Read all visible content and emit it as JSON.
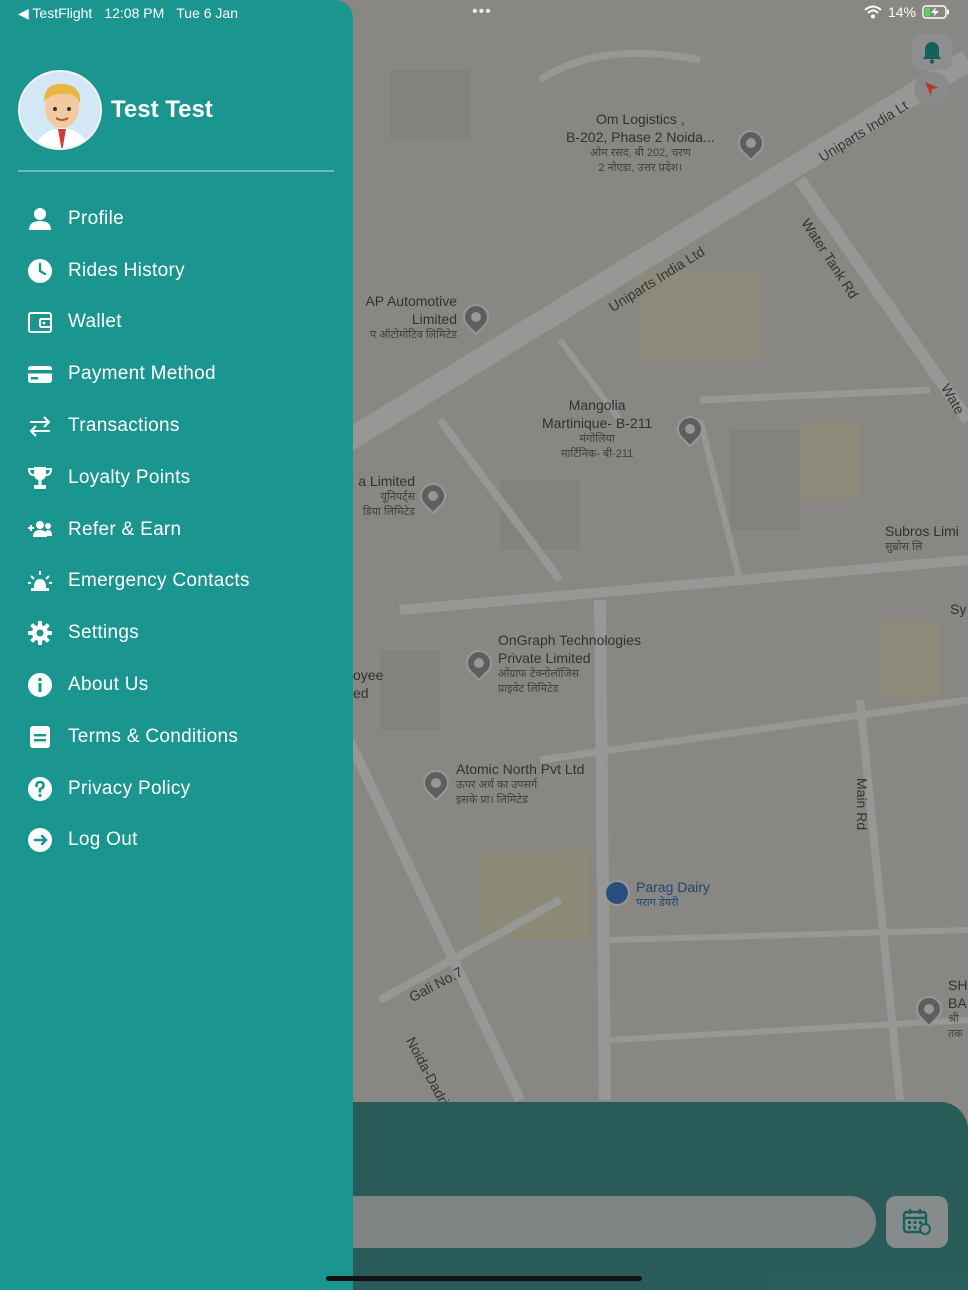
{
  "status_bar": {
    "back_app": "◀ TestFlight",
    "time": "12:08 PM",
    "date": "Tue 6 Jan",
    "battery": "14%"
  },
  "map": {
    "places": [
      {
        "name": "Om Logistics ,\nB-202, Phase 2 Noida...",
        "sub": "ओम रसद, बी 202, चरण\n2 नोएडा, उत्तर प्रदेश।"
      },
      {
        "name": "AP Automotive\nLimited",
        "sub": "प ऑटोमोटिव लिमिटेड"
      },
      {
        "name": "Mangolia\nMartinique- B-211",
        "sub": "मंगोलिया\nमार्टिनिक- बी-211"
      },
      {
        "name": "a Limited",
        "sub": "यूनिपर्ट्स\nडिया लिमिटेड"
      },
      {
        "name": "Subros Limi",
        "sub": "सुब्रोस लि"
      },
      {
        "name": "Sy",
        "sub": ""
      },
      {
        "name": "OnGraph Technologies\nPrivate Limited",
        "sub": "ओंग्राफ टेक्नोलॉजिस\nप्राइवेट लिमिटेड"
      },
      {
        "name": "oyee\ned",
        "sub": ""
      },
      {
        "name": "Atomic North Pvt Ltd",
        "sub": "ऊपर अर्थ का उपसर्ग\nइसके प्रा। लिमिटेड"
      },
      {
        "name": "Parag Dairy",
        "sub": "पराग डेयरी"
      },
      {
        "name": "SH\nBA",
        "sub": "श्री\nतक"
      }
    ],
    "roads": [
      "Uniparts India Ltd",
      "Uniparts India Lt",
      "Water Tank Rd",
      "Wate",
      "Main Rd",
      "Gali No.7",
      "Noida-Dadri R"
    ]
  },
  "drawer": {
    "user_name": "Test Test",
    "menu": [
      {
        "label": "Profile",
        "icon": "person-icon"
      },
      {
        "label": "Rides History",
        "icon": "clock-icon"
      },
      {
        "label": "Wallet",
        "icon": "wallet-icon"
      },
      {
        "label": "Payment Method",
        "icon": "card-icon"
      },
      {
        "label": "Transactions",
        "icon": "swap-arrows-icon"
      },
      {
        "label": "Loyalty Points",
        "icon": "trophy-icon"
      },
      {
        "label": "Refer & Earn",
        "icon": "add-users-icon"
      },
      {
        "label": "Emergency Contacts",
        "icon": "siren-icon"
      },
      {
        "label": "Settings",
        "icon": "gear-icon"
      },
      {
        "label": "About Us",
        "icon": "info-icon"
      },
      {
        "label": "Terms & Conditions",
        "icon": "document-icon"
      },
      {
        "label": "Privacy Policy",
        "icon": "question-icon"
      },
      {
        "label": "Log Out",
        "icon": "logout-icon"
      }
    ]
  },
  "colors": {
    "drawer_bg": "#1b9590",
    "text": "#ffffff",
    "sheet_bg": "#1f6e69"
  }
}
